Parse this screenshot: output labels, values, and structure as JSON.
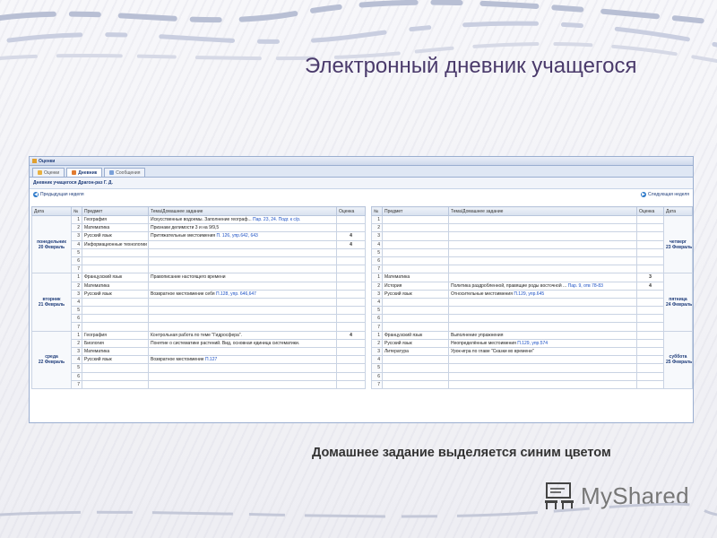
{
  "slide": {
    "title": "Электронный дневник учащегося",
    "caption": "Домашнее задание выделяется синим цветом",
    "logo_text": "MyShared"
  },
  "app": {
    "window_title": "Оценки",
    "tabs": [
      {
        "label": "Оценки",
        "active": false
      },
      {
        "label": "Дневник",
        "active": true
      },
      {
        "label": "Сообщения",
        "active": false
      }
    ],
    "panel_title": "Дневник учащегося Драгон-раз Г. Д.",
    "prev_week": "Предыдущая неделя",
    "next_week": "Следующая неделя",
    "columns_left": [
      "Дата",
      "№",
      "Предмет",
      "Тема/Домашнее задание",
      "Оценка"
    ],
    "columns_right": [
      "№",
      "Предмет",
      "Тема/Домашнее задание",
      "Оценка",
      "Дата"
    ]
  },
  "left_days": [
    {
      "day": "понедельник",
      "date": "20 Февраль",
      "lessons": [
        {
          "n": "1",
          "subject": "География",
          "topic": "Искусственные водоемы. Заполнение географ...",
          "hw": "Пар. 23, 24. Подг. к с/р.",
          "grade": ""
        },
        {
          "n": "2",
          "subject": "Математика",
          "topic": "Признаки делимости 3 и на 9/9,5",
          "hw": "",
          "grade": ""
        },
        {
          "n": "3",
          "subject": "Русский язык",
          "topic": "Притяжательные местоимения",
          "hw": "П. 126, упр.642, 643",
          "grade": "4"
        },
        {
          "n": "4",
          "subject": "Информационные технологии",
          "topic": "",
          "hw": "",
          "grade": "4"
        },
        {
          "n": "5",
          "subject": "",
          "topic": "",
          "hw": "",
          "grade": ""
        },
        {
          "n": "6",
          "subject": "",
          "topic": "",
          "hw": "",
          "grade": ""
        },
        {
          "n": "7",
          "subject": "",
          "topic": "",
          "hw": "",
          "grade": ""
        }
      ]
    },
    {
      "day": "вторник",
      "date": "21 Февраль",
      "lessons": [
        {
          "n": "1",
          "subject": "Французский язык",
          "topic": "Правописание настоящего времени",
          "hw": "",
          "grade": ""
        },
        {
          "n": "2",
          "subject": "Математика",
          "topic": "",
          "hw": "",
          "grade": ""
        },
        {
          "n": "3",
          "subject": "Русский язык",
          "topic": "Возвратное местоимение себя",
          "hw": "П.128, упр. 646,647",
          "grade": ""
        },
        {
          "n": "4",
          "subject": "",
          "topic": "",
          "hw": "",
          "grade": ""
        },
        {
          "n": "5",
          "subject": "",
          "topic": "",
          "hw": "",
          "grade": ""
        },
        {
          "n": "6",
          "subject": "",
          "topic": "",
          "hw": "",
          "grade": ""
        },
        {
          "n": "7",
          "subject": "",
          "topic": "",
          "hw": "",
          "grade": ""
        }
      ]
    },
    {
      "day": "среда",
      "date": "22 Февраль",
      "lessons": [
        {
          "n": "1",
          "subject": "География",
          "topic": "Контрольная работа по теме \"Гидросфера\".",
          "hw": "",
          "grade": "4"
        },
        {
          "n": "2",
          "subject": "Биология",
          "topic": "Понятие о систематике растений. Вид, основная единица систематики.",
          "hw": "",
          "grade": ""
        },
        {
          "n": "3",
          "subject": "Математика",
          "topic": "",
          "hw": "",
          "grade": ""
        },
        {
          "n": "4",
          "subject": "Русский язык",
          "topic": "Возвратное местоимение",
          "hw": "П.127",
          "grade": ""
        },
        {
          "n": "5",
          "subject": "",
          "topic": "",
          "hw": "",
          "grade": ""
        },
        {
          "n": "6",
          "subject": "",
          "topic": "",
          "hw": "",
          "grade": ""
        },
        {
          "n": "7",
          "subject": "",
          "topic": "",
          "hw": "",
          "grade": ""
        }
      ]
    }
  ],
  "right_days": [
    {
      "day": "четверг",
      "date": "23 Февраль",
      "lessons": [
        {
          "n": "1",
          "subject": "",
          "topic": "",
          "hw": "",
          "grade": ""
        },
        {
          "n": "2",
          "subject": "",
          "topic": "",
          "hw": "",
          "grade": ""
        },
        {
          "n": "3",
          "subject": "",
          "topic": "",
          "hw": "",
          "grade": ""
        },
        {
          "n": "4",
          "subject": "",
          "topic": "",
          "hw": "",
          "grade": ""
        },
        {
          "n": "5",
          "subject": "",
          "topic": "",
          "hw": "",
          "grade": ""
        },
        {
          "n": "6",
          "subject": "",
          "topic": "",
          "hw": "",
          "grade": ""
        },
        {
          "n": "7",
          "subject": "",
          "topic": "",
          "hw": "",
          "grade": ""
        }
      ]
    },
    {
      "day": "пятница",
      "date": "24 Февраль",
      "lessons": [
        {
          "n": "1",
          "subject": "Математика",
          "topic": "",
          "hw": "",
          "grade": "3"
        },
        {
          "n": "2",
          "subject": "История",
          "topic": "Политика раздробленной, правящие роды восточной ...",
          "hw": "Пар. 9, отв 78-83",
          "grade": "4"
        },
        {
          "n": "3",
          "subject": "Русский язык",
          "topic": "Относительные местоимения",
          "hw": "П.129, упр.645",
          "grade": ""
        },
        {
          "n": "4",
          "subject": "",
          "topic": "",
          "hw": "",
          "grade": ""
        },
        {
          "n": "5",
          "subject": "",
          "topic": "",
          "hw": "",
          "grade": ""
        },
        {
          "n": "6",
          "subject": "",
          "topic": "",
          "hw": "",
          "grade": ""
        },
        {
          "n": "7",
          "subject": "",
          "topic": "",
          "hw": "",
          "grade": ""
        }
      ]
    },
    {
      "day": "суббота",
      "date": "25 Февраль",
      "lessons": [
        {
          "n": "1",
          "subject": "Французский язык",
          "topic": "Выполнение упражнения",
          "hw": "",
          "grade": ""
        },
        {
          "n": "2",
          "subject": "Русский язык",
          "topic": "Неопределённые местоимения",
          "hw": "П.129, упр.574",
          "grade": ""
        },
        {
          "n": "3",
          "subject": "Литература",
          "topic": "Урок-игра по главе \"Сказки во времени\"",
          "hw": "",
          "grade": ""
        },
        {
          "n": "4",
          "subject": "",
          "topic": "",
          "hw": "",
          "grade": ""
        },
        {
          "n": "5",
          "subject": "",
          "topic": "",
          "hw": "",
          "grade": ""
        },
        {
          "n": "6",
          "subject": "",
          "topic": "",
          "hw": "",
          "grade": ""
        },
        {
          "n": "7",
          "subject": "",
          "topic": "",
          "hw": "",
          "grade": ""
        }
      ]
    }
  ],
  "colors": {
    "hw_link": "#1a4fc4",
    "title": "#4a3a6b",
    "grid_border": "#c9d3e3"
  }
}
